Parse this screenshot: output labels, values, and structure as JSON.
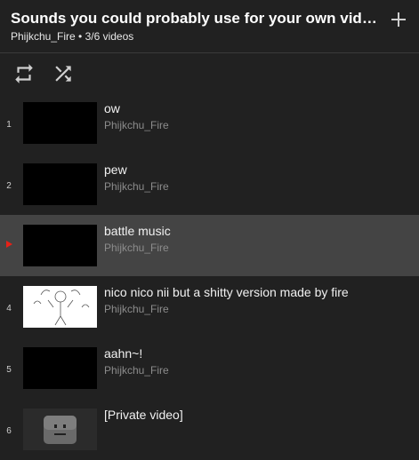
{
  "playlist": {
    "title": "Sounds you could probably use for your own videos without getting copyrighted",
    "subtitle": "Phijkchu_Fire • 3/6 videos"
  },
  "controls": {
    "loop_icon": "loop-icon",
    "shuffle_icon": "shuffle-icon",
    "add_icon": "plus-icon"
  },
  "items": [
    {
      "index": "1",
      "title": "ow",
      "channel": "Phijkchu_Fire"
    },
    {
      "index": "2",
      "title": "pew",
      "channel": "Phijkchu_Fire"
    },
    {
      "index": "",
      "title": "battle music",
      "channel": "Phijkchu_Fire",
      "playing": true
    },
    {
      "index": "4",
      "title": "nico nico nii but a shitty version made by fire",
      "channel": "Phijkchu_Fire"
    },
    {
      "index": "5",
      "title": "aahn~!",
      "channel": "Phijkchu_Fire"
    },
    {
      "index": "6",
      "title": "[Private video]",
      "channel": ""
    }
  ],
  "colors": {
    "background": "#212121",
    "active_row": "#444444",
    "now_playing": "#e62117"
  }
}
